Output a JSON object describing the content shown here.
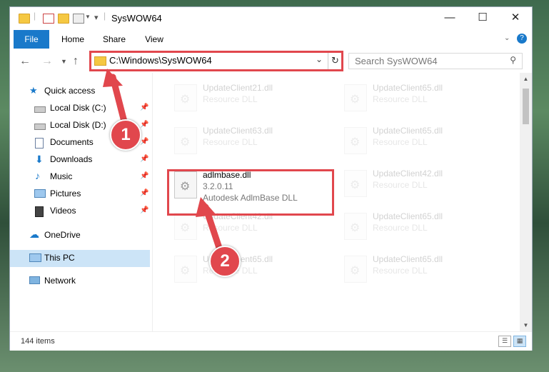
{
  "window": {
    "title": "SysWOW64"
  },
  "ribbon": {
    "tabs": [
      "File",
      "Home",
      "Share",
      "View"
    ]
  },
  "address": {
    "path": "C:\\Windows\\SysWOW64",
    "search_placeholder": "Search SysWOW64"
  },
  "sidebar": {
    "items": [
      {
        "label": "Quick access"
      },
      {
        "label": "Local Disk (C:)"
      },
      {
        "label": "Local Disk (D:)"
      },
      {
        "label": "Documents"
      },
      {
        "label": "Downloads"
      },
      {
        "label": "Music"
      },
      {
        "label": "Pictures"
      },
      {
        "label": "Videos"
      },
      {
        "label": "OneDrive"
      },
      {
        "label": "This PC"
      },
      {
        "label": "Network"
      }
    ]
  },
  "files": [
    {
      "name": "UpdateClient21.dll",
      "desc": "Resource DLL"
    },
    {
      "name": "UpdateClient65.dll",
      "desc": "Resource DLL"
    },
    {
      "name": "UpdateClient63.dll",
      "desc": "Resource DLL"
    },
    {
      "name": "UpdateClient65.dll",
      "desc": "Resource DLL"
    },
    {
      "name": "adlmbase.dll",
      "version": "3.2.0.11",
      "desc": "Autodesk AdlmBase DLL"
    },
    {
      "name": "UpdateClient42.dll",
      "desc": "Resource DLL"
    },
    {
      "name": "UpdateClient42.dll",
      "desc": "Resource DLL"
    },
    {
      "name": "UpdateClient65.dll",
      "desc": "Resource DLL"
    },
    {
      "name": "UpdateClient65.dll",
      "desc": "Resource DLL"
    },
    {
      "name": "UpdateClient65.dll",
      "desc": "Resource DLL"
    }
  ],
  "status": {
    "item_count": "144 items"
  },
  "annotations": {
    "step1": "1",
    "step2": "2"
  },
  "colors": {
    "accent": "#1979ca",
    "highlight": "#e1474d",
    "selection": "#cce4f7"
  }
}
